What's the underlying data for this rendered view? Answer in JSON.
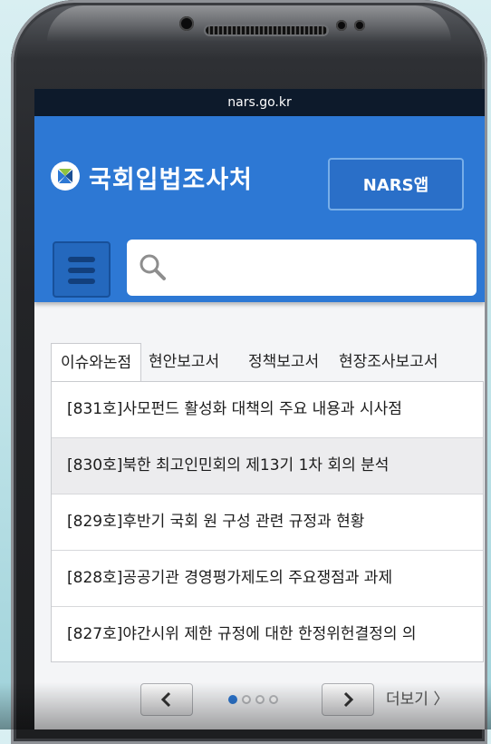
{
  "browser": {
    "url": "nars.go.kr"
  },
  "header": {
    "site_title": "국회입법조사처",
    "app_button_label": "NARS앱",
    "search_placeholder": ""
  },
  "tabs": [
    {
      "label": "이슈와논점",
      "active": true
    },
    {
      "label": "현안보고서",
      "active": false
    },
    {
      "label": "정책보고서",
      "active": false
    },
    {
      "label": "현장조사보고서",
      "active": false
    }
  ],
  "articles": [
    {
      "title": "[831호]사모펀드 활성화 대책의 주요 내용과 시사점",
      "highlighted": false
    },
    {
      "title": "[830호]북한 최고인민회의 제13기 1차 회의 분석",
      "highlighted": true
    },
    {
      "title": "[829호]후반기 국회 원 구성 관련 규정과 현황",
      "highlighted": false
    },
    {
      "title": "[828호]공공기관 경영평가제도의 주요쟁점과 과제",
      "highlighted": false
    },
    {
      "title": "[827호]야간시위 제한 규정에 대한 한정위헌결정의 의",
      "highlighted": false
    }
  ],
  "pager": {
    "prev_icon": "chevron-left-icon",
    "next_icon": "chevron-right-icon",
    "page_count": 4,
    "active_page": 1,
    "more_label": "더보기 〉"
  },
  "colors": {
    "header_blue": "#2d78d4",
    "active_dot": "#2d78d4",
    "status_bar": "#0d1a2b"
  }
}
